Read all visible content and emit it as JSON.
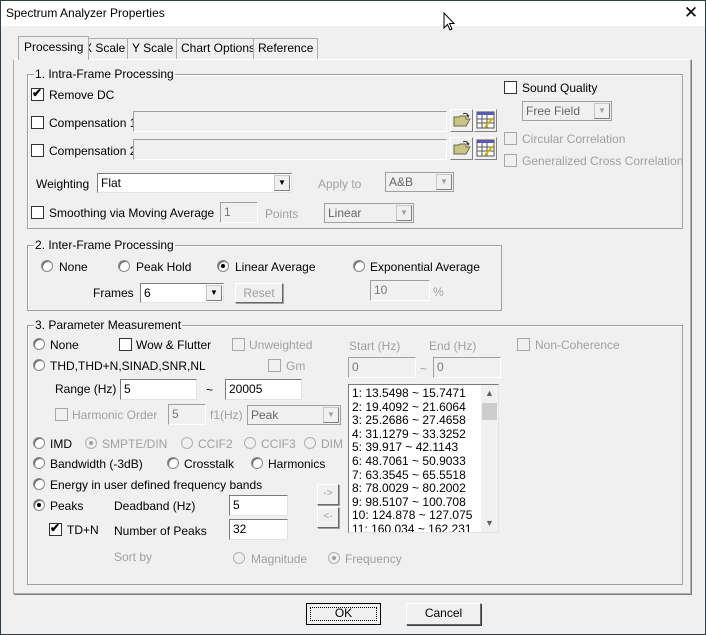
{
  "window": {
    "title": "Spectrum Analyzer Properties",
    "close_icon": "close-icon"
  },
  "tabs": [
    {
      "label": "Processing",
      "active": true
    },
    {
      "label": "X Scale",
      "active": false
    },
    {
      "label": "Y Scale",
      "active": false
    },
    {
      "label": "Chart Options",
      "active": false
    },
    {
      "label": "Reference",
      "active": false
    }
  ],
  "intra": {
    "title": "1. Intra-Frame Processing",
    "remove_dc": {
      "label": "Remove DC",
      "checked": true
    },
    "compensation1": {
      "label": "Compensation 1",
      "checked": false,
      "value": ""
    },
    "compensation2": {
      "label": "Compensation 2",
      "checked": false,
      "value": ""
    },
    "weighting": {
      "label": "Weighting",
      "value": "Flat"
    },
    "apply_to": {
      "label": "Apply to",
      "value": "A&B"
    },
    "smoothing": {
      "label": "Smoothing via Moving Average",
      "checked": false,
      "points_value": "1",
      "points_label": "Points",
      "mode": "Linear"
    },
    "sound_quality": {
      "label": "Sound Quality",
      "checked": false,
      "field_mode": "Free Field"
    },
    "circular_correlation": {
      "label": "Circular Correlation",
      "checked": false
    },
    "gcc": {
      "label": "Generalized Cross Correlation",
      "checked": false
    }
  },
  "inter": {
    "title": "2. Inter-Frame Processing",
    "options": [
      {
        "label": "None",
        "selected": false
      },
      {
        "label": "Peak Hold",
        "selected": false
      },
      {
        "label": "Linear Average",
        "selected": true
      },
      {
        "label": "Exponential Average",
        "selected": false
      }
    ],
    "frames_label": "Frames",
    "frames_value": "6",
    "reset_label": "Reset",
    "exp_value": "10",
    "exp_unit": "%"
  },
  "param": {
    "title": "3. Parameter Measurement",
    "none_label": "None",
    "wow_flutter": {
      "label": "Wow & Flutter",
      "checked": false
    },
    "unweighted": {
      "label": "Unweighted",
      "checked": false
    },
    "thd_label": "THD,THD+N,SINAD,SNR,NL",
    "gm": {
      "label": "Gm",
      "checked": false
    },
    "range_label": "Range (Hz)",
    "range_start": "5",
    "range_tilde": "~",
    "range_end": "20005",
    "harmonic_order": {
      "label": "Harmonic Order",
      "checked": false,
      "value": "5"
    },
    "f1_label": "f1(Hz)",
    "f1_value": "Peak",
    "start_label": "Start (Hz)",
    "end_label": "End (Hz)",
    "start_value": "0",
    "end_value": "0",
    "non_coherence": {
      "label": "Non-Coherence",
      "checked": false
    },
    "imd_label": "IMD",
    "imd_options": [
      {
        "label": "SMPTE/DIN",
        "selected": true
      },
      {
        "label": "CCIF2",
        "selected": false
      },
      {
        "label": "CCIF3",
        "selected": false
      },
      {
        "label": "DIM",
        "selected": false
      }
    ],
    "bandwidth_label": "Bandwidth (-3dB)",
    "crosstalk_label": "Crosstalk",
    "harmonics_label": "Harmonics",
    "energy_label": "Energy in user defined frequency bands",
    "peaks_label": "Peaks",
    "peaks_selected": true,
    "deadband_label": "Deadband (Hz)",
    "deadband_value": "5",
    "tdn": {
      "label": "TD+N",
      "checked": true
    },
    "num_peaks_label": "Number of Peaks",
    "num_peaks_value": "32",
    "add_label": "->",
    "remove_label": "<-",
    "sort_by_label": "Sort by",
    "sort_magnitude": "Magnitude",
    "sort_frequency": "Frequency",
    "sort_selected": "Frequency",
    "bands": [
      "1: 13.5498 ~ 15.7471",
      "2: 19.4092 ~ 21.6064",
      "3: 25.2686 ~ 27.4658",
      "4: 31.1279 ~ 33.3252",
      "5: 39.917 ~ 42.1143",
      "6: 48.7061 ~ 50.9033",
      "7: 63.3545 ~ 65.5518",
      "8: 78.0029 ~ 80.2002",
      "9: 98.5107 ~ 100.708",
      "10: 124.878 ~ 127.075",
      "11: 160.034 ~ 162.231"
    ]
  },
  "footer": {
    "ok_label": "OK",
    "cancel_label": "Cancel"
  }
}
